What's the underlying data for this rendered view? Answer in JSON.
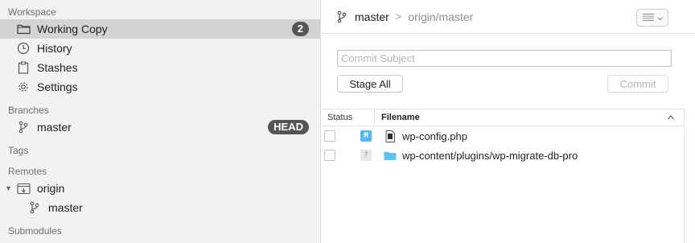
{
  "sidebar": {
    "workspace_label": "Workspace",
    "workspace_items": [
      {
        "label": "Working Copy",
        "icon": "folder-icon",
        "badge": "2",
        "selected": true
      },
      {
        "label": "History",
        "icon": "clock-icon"
      },
      {
        "label": "Stashes",
        "icon": "clipboard-icon"
      },
      {
        "label": "Settings",
        "icon": "gear-icon"
      }
    ],
    "branches_label": "Branches",
    "branches": [
      {
        "label": "master",
        "icon": "branch-icon",
        "badge": "HEAD"
      }
    ],
    "tags_label": "Tags",
    "remotes_label": "Remotes",
    "remotes": [
      {
        "label": "origin",
        "icon": "remote-icon",
        "expanded": true,
        "branches": [
          {
            "label": "master",
            "icon": "branch-icon"
          }
        ]
      }
    ],
    "submodules_label": "Submodules"
  },
  "header": {
    "branch": "master",
    "separator": ">",
    "upstream": "origin/master",
    "view_menu_icon": "list-view-icon"
  },
  "commit": {
    "subject_placeholder": "Commit Subject",
    "subject_value": "",
    "stage_all_label": "Stage All",
    "commit_label": "Commit"
  },
  "table": {
    "columns": [
      "Status",
      "Filename"
    ],
    "sort_indicator": "^",
    "rows": [
      {
        "checked": false,
        "status": "M",
        "status_kind": "modified",
        "icon": "php-file-icon",
        "filename": "wp-config.php"
      },
      {
        "checked": false,
        "status": "?",
        "status_kind": "untracked",
        "icon": "folder-icon",
        "filename": "wp-content/plugins/wp-migrate-db-pro"
      }
    ]
  },
  "colors": {
    "sidebar_bg": "#f2f2f2",
    "selection_bg": "#d4d4d4",
    "badge_bg": "#555555",
    "modified_tag": "#5ab7ea",
    "folder_blue": "#61c3f0"
  }
}
